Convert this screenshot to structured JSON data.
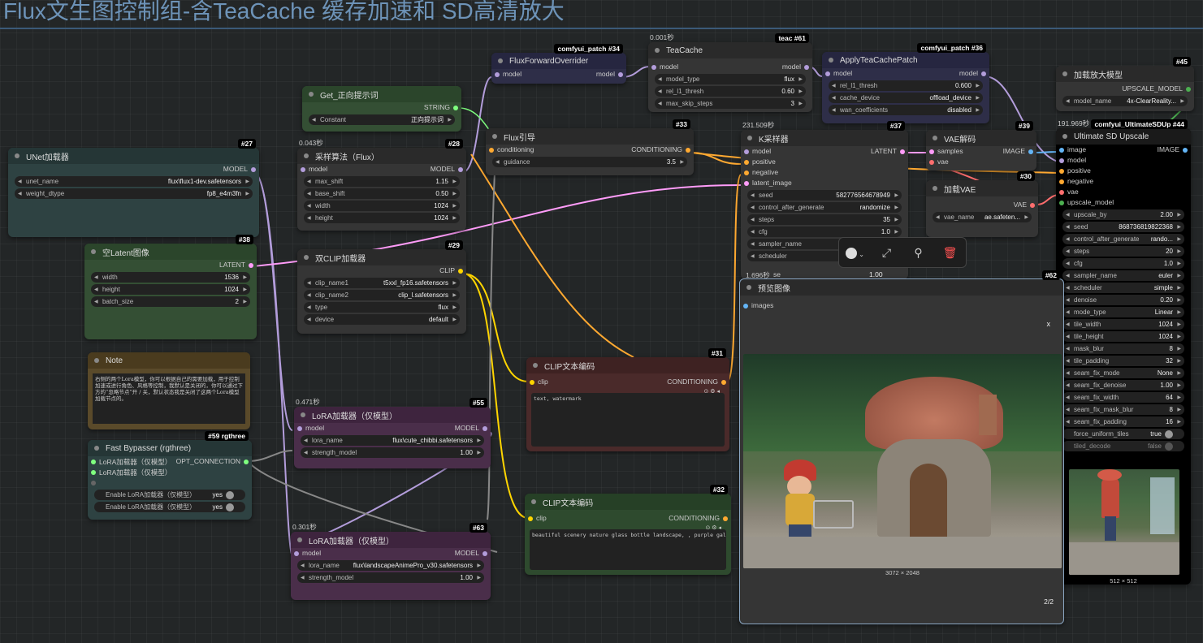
{
  "group": {
    "title": "Flux文生图控制组-含TeaCache 缓存加速和 SD高清放大"
  },
  "nodes": {
    "unet": {
      "title": "UNet加载器",
      "id": "#27",
      "out": "MODEL",
      "widgets": [
        {
          "label": "unet_name",
          "value": "flux\\flux1-dev.safetensors"
        },
        {
          "label": "weight_dtype",
          "value": "fp8_e4m3fn"
        }
      ]
    },
    "latent": {
      "title": "空Latent图像",
      "id": "#38",
      "out": "LATENT",
      "widgets": [
        {
          "label": "width",
          "value": "1536"
        },
        {
          "label": "height",
          "value": "1024"
        },
        {
          "label": "batch_size",
          "value": "2"
        }
      ]
    },
    "note": {
      "title": "Note",
      "text": "右侧的两个Lora模型，你可以根据自己的需要加载，用于控制加速或进行角色、风格等控制，我默认是关闭的，你可以通过下方的“忽略节点”开 / 关，默认状态我是关闭了这两个Lora模型加载节点的。"
    },
    "bypasser": {
      "title": "Fast Bypasser (rgthree)",
      "id": "#59 rgthree",
      "in1": "LoRA加载器（仅模型）",
      "in2": "LoRA加载器（仅模型）",
      "out": "OPT_CONNECTION",
      "widgets": [
        {
          "label": "Enable LoRA加载器（仅模型）",
          "value": "yes"
        },
        {
          "label": "Enable LoRA加载器（仅模型）",
          "value": "yes"
        }
      ]
    },
    "getprompt": {
      "title": "Get_正向提示词",
      "out": "STRING",
      "widgets": [
        {
          "label": "Constant",
          "value": "正向提示词"
        }
      ]
    },
    "sampling": {
      "title": "采样算法（Flux）",
      "id": "#28",
      "timing": "0.043秒",
      "in": "model",
      "out": "MODEL",
      "widgets": [
        {
          "label": "max_shift",
          "value": "1.15"
        },
        {
          "label": "base_shift",
          "value": "0.50"
        },
        {
          "label": "width",
          "value": "1024"
        },
        {
          "label": "height",
          "value": "1024"
        }
      ]
    },
    "dualclip": {
      "title": "双CLIP加载器",
      "id": "#29",
      "out": "CLIP",
      "widgets": [
        {
          "label": "clip_name1",
          "value": "t5xxl_fp16.safetensors"
        },
        {
          "label": "clip_name2",
          "value": "clip_l.safetensors"
        },
        {
          "label": "type",
          "value": "flux"
        },
        {
          "label": "device",
          "value": "default"
        }
      ]
    },
    "lora1": {
      "title": "LoRA加载器（仅模型）",
      "id": "#55",
      "timing": "0.471秒",
      "in": "model",
      "out": "MODEL",
      "widgets": [
        {
          "label": "lora_name",
          "value": "flux\\cute_chibbi.safetensors"
        },
        {
          "label": "strength_model",
          "value": "1.00"
        }
      ]
    },
    "lora2": {
      "title": "LoRA加载器（仅模型）",
      "id": "#63",
      "timing": "0.301秒",
      "in": "model",
      "out": "MODEL",
      "widgets": [
        {
          "label": "lora_name",
          "value": "flux\\landscapeAnimePro_v30.safetensors"
        },
        {
          "label": "strength_model",
          "value": "1.00"
        }
      ]
    },
    "ffo": {
      "title": "FluxForwardOverrider",
      "id": "comfyui_patch #34",
      "in": "model",
      "out": "model"
    },
    "teacache": {
      "title": "TeaCache",
      "id": "teac #61",
      "timing": "0.001秒",
      "in": "model",
      "out": "model",
      "widgets": [
        {
          "label": "model_type",
          "value": "flux"
        },
        {
          "label": "rel_l1_thresh",
          "value": "0.60"
        },
        {
          "label": "max_skip_steps",
          "value": "3"
        }
      ]
    },
    "applytea": {
      "title": "ApplyTeaCachePatch",
      "id": "comfyui_patch #36",
      "in": "model",
      "out": "model",
      "widgets": [
        {
          "label": "rel_l1_thresh",
          "value": "0.600"
        },
        {
          "label": "cache_device",
          "value": "offload_device"
        },
        {
          "label": "wan_coefficients",
          "value": "disabled"
        }
      ]
    },
    "guidance": {
      "title": "Flux引导",
      "id": "#33",
      "in": "conditioning",
      "out": "CONDITIONING",
      "widgets": [
        {
          "label": "guidance",
          "value": "3.5"
        }
      ]
    },
    "ksampler": {
      "title": "K采样器",
      "id": "#37",
      "timing": "231.509秒",
      "out": "LATENT",
      "inputs": [
        "model",
        "positive",
        "negative",
        "latent_image"
      ],
      "widgets": [
        {
          "label": "seed",
          "value": "582776564678949"
        },
        {
          "label": "control_after_generate",
          "value": "randomize"
        },
        {
          "label": "steps",
          "value": "35"
        },
        {
          "label": "cfg",
          "value": "1.0"
        },
        {
          "label": "sampler_name",
          "value": ""
        },
        {
          "label": "scheduler",
          "value": ""
        }
      ],
      "timing2": "1.696秒",
      "extra": {
        "label": "se",
        "value": "1.00"
      }
    },
    "vaedecode": {
      "title": "VAE解码",
      "id": "#39",
      "out": "IMAGE",
      "in1": "samples",
      "in2": "vae"
    },
    "vaeload": {
      "title": "加载VAE",
      "id": "#30",
      "out": "VAE",
      "widgets": [
        {
          "label": "vae_name",
          "value": "ae.safeten..."
        }
      ]
    },
    "upmodel": {
      "title": "加载放大模型",
      "id": "#45",
      "out": "UPSCALE_MODEL",
      "widgets": [
        {
          "label": "model_name",
          "value": "4x-ClearReality..."
        }
      ]
    },
    "usdu": {
      "title": "Ultimate SD Upscale",
      "id": "comfyui_UltimateSDUp #44",
      "timing": "191.969秒",
      "out": "IMAGE",
      "inputs": [
        "image",
        "model",
        "positive",
        "negative",
        "vae",
        "upscale_model"
      ],
      "widgets": [
        {
          "label": "upscale_by",
          "value": "2.00"
        },
        {
          "label": "seed",
          "value": "868736819822368"
        },
        {
          "label": "control_after_generate",
          "value": "rando..."
        },
        {
          "label": "steps",
          "value": "20"
        },
        {
          "label": "cfg",
          "value": "1.0"
        },
        {
          "label": "sampler_name",
          "value": "euler"
        },
        {
          "label": "scheduler",
          "value": "simple"
        },
        {
          "label": "denoise",
          "value": "0.20"
        },
        {
          "label": "mode_type",
          "value": "Linear"
        },
        {
          "label": "tile_width",
          "value": "1024"
        },
        {
          "label": "tile_height",
          "value": "1024"
        },
        {
          "label": "mask_blur",
          "value": "8"
        },
        {
          "label": "tile_padding",
          "value": "32"
        },
        {
          "label": "seam_fix_mode",
          "value": "None"
        },
        {
          "label": "seam_fix_denoise",
          "value": "1.00"
        },
        {
          "label": "seam_fix_width",
          "value": "64"
        },
        {
          "label": "seam_fix_mask_blur",
          "value": "8"
        },
        {
          "label": "seam_fix_padding",
          "value": "16"
        }
      ],
      "toggles": [
        {
          "label": "force_uniform_tiles",
          "value": "true"
        },
        {
          "label": "tiled_decode",
          "value": "false"
        }
      ],
      "size": "512 × 512"
    },
    "cliptext1": {
      "title": "CLIP文本编码",
      "id": "#31",
      "in": "clip",
      "out": "CONDITIONING",
      "text": "text, watermark"
    },
    "cliptext2": {
      "title": "CLIP文本编码",
      "id": "#32",
      "in": "clip",
      "out": "CONDITIONING",
      "text": "beautiful scenery nature glass bottle landscape, , purple galaxy bottle,"
    },
    "preview": {
      "title": "预览图像",
      "id": "#62",
      "in": "images",
      "close": "x",
      "size": "3072 × 2048",
      "page": "2/2"
    }
  },
  "toolbar": {
    "icons": [
      "color-circle-icon",
      "bypass-icon",
      "pin-icon",
      "delete-icon"
    ]
  },
  "colors": {
    "model": "#b39ddb",
    "clip": "#ffd500",
    "cond": "#ffa931",
    "latent": "#ff9cf9",
    "vae": "#ff6e6e",
    "image": "#64b5f6",
    "string": "#7fff7f"
  }
}
